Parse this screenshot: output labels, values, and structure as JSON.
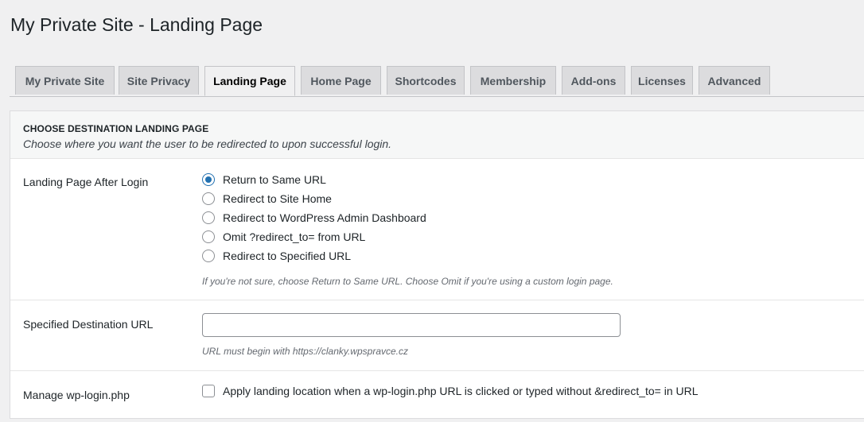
{
  "page": {
    "title": "My Private Site - Landing Page"
  },
  "tabs": [
    {
      "label": "My Private Site",
      "active": false
    },
    {
      "label": "Site Privacy",
      "active": false
    },
    {
      "label": "Landing Page",
      "active": true
    },
    {
      "label": "Home Page",
      "active": false
    },
    {
      "label": "Shortcodes",
      "active": false
    },
    {
      "label": "Membership",
      "active": false
    },
    {
      "label": "Add-ons",
      "active": false
    },
    {
      "label": "Licenses",
      "active": false
    },
    {
      "label": "Advanced",
      "active": false
    }
  ],
  "section": {
    "title": "CHOOSE DESTINATION LANDING PAGE",
    "description": "Choose where you want the user to be redirected to upon successful login."
  },
  "landing": {
    "label": "Landing Page After Login",
    "options": [
      {
        "label": "Return to Same URL",
        "checked": true
      },
      {
        "label": "Redirect to Site Home",
        "checked": false
      },
      {
        "label": "Redirect to WordPress Admin Dashboard",
        "checked": false
      },
      {
        "label": "Omit ?redirect_to= from URL",
        "checked": false
      },
      {
        "label": "Redirect to Specified URL",
        "checked": false
      }
    ],
    "hint": "If you're not sure, choose Return to Same URL. Choose Omit if you're using a custom login page."
  },
  "destination": {
    "label": "Specified Destination URL",
    "value": "",
    "hint": "URL must begin with https://clanky.wpspravce.cz"
  },
  "wplogin": {
    "label": "Manage wp-login.php",
    "checkbox_label": "Apply landing location when a wp-login.php URL is clicked or typed without &redirect_to= in URL",
    "checked": false
  },
  "colors": {
    "accent": "#2271b1",
    "background": "#f0f0f1",
    "tab_inactive": "#dcdcde"
  }
}
